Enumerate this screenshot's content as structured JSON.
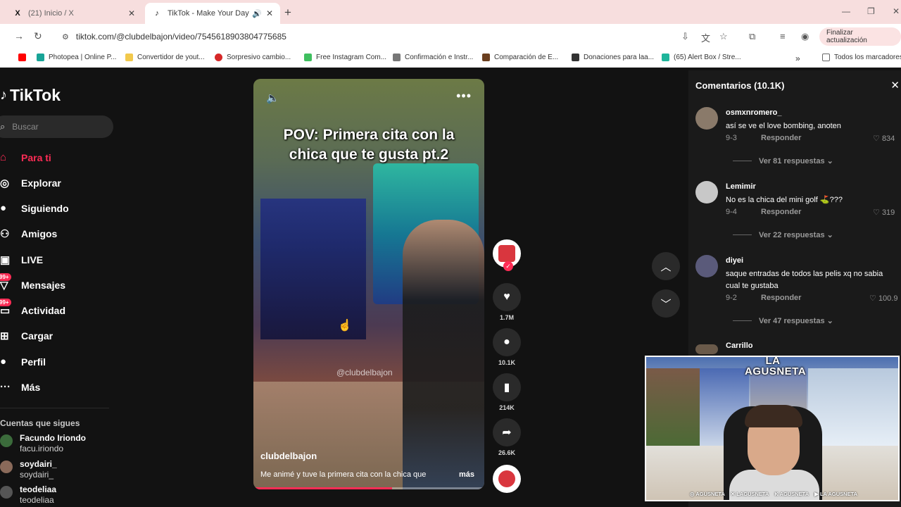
{
  "browser": {
    "tabs": [
      {
        "icon": "X",
        "title": "(21) Inicio / X",
        "close": "✕"
      },
      {
        "icon": "♪",
        "title": "TikTok - Make Your Day",
        "audio": "🔊",
        "close": "✕"
      }
    ],
    "new_tab": "+",
    "url": "tiktok.com/@clubdelbajon/video/7545618903804775685",
    "update_button": "Finalizar actualización",
    "bookmarks": [
      {
        "label": "",
        "color": "#ff0000"
      },
      {
        "label": "Photopea | Online P...",
        "color": "#18a497"
      },
      {
        "label": "Convertidor de yout...",
        "color": "#f2c94c"
      },
      {
        "label": "Sorpresivo cambio...",
        "color": "#d62828"
      },
      {
        "label": "Free Instagram Com...",
        "color": "#3fbf5f"
      },
      {
        "label": "Confirmación e Instr...",
        "color": "#777777"
      },
      {
        "label": "Comparación de E...",
        "color": "#6b3f1f"
      },
      {
        "label": "Donaciones para laa...",
        "color": "#333333"
      },
      {
        "label": "(65) Alert Box / Stre...",
        "color": "#1fb59b"
      },
      {
        "label": "Todos los marcadores",
        "color": "#666666"
      }
    ],
    "bookmarks_more": "»"
  },
  "sidebar": {
    "logo": "TikTok",
    "search_placeholder": "Buscar",
    "nav": [
      {
        "label": "Para ti",
        "icon": "⌂",
        "active": true
      },
      {
        "label": "Explorar",
        "icon": "◎"
      },
      {
        "label": "Siguiendo",
        "icon": "●"
      },
      {
        "label": "Amigos",
        "icon": "⚇"
      },
      {
        "label": "LIVE",
        "icon": "▣"
      },
      {
        "label": "Mensajes",
        "icon": "▽",
        "badge": "99+"
      },
      {
        "label": "Actividad",
        "icon": "▭",
        "badge": "99+"
      },
      {
        "label": "Cargar",
        "icon": "⊞"
      },
      {
        "label": "Perfil",
        "icon": "●"
      },
      {
        "label": "Más",
        "icon": "···"
      }
    ],
    "following_title": "Cuentas que sigues",
    "following": [
      {
        "name": "Facundo Iriondo",
        "handle": "facu.iriondo",
        "color": "#3b6b3b"
      },
      {
        "name": "soydairi_",
        "handle": "soydairi_",
        "color": "#8a6a5a"
      },
      {
        "name": "teodeliaa",
        "handle": "teodeliaa",
        "color": "#555555"
      }
    ]
  },
  "video": {
    "caption_line1": "POV: Primera cita con la",
    "caption_line2": "chica que te gusta pt.2",
    "watermark": "@clubdelbajon",
    "author": "clubdelbajon",
    "description": "Me animé y tuve la primera cita con la chica que",
    "more": "más",
    "progress": 0.6
  },
  "actions": {
    "likes": "1.7M",
    "comments": "10.1K",
    "saves": "214K",
    "shares": "26.6K"
  },
  "comments": {
    "title": "Comentarios (10.1K)",
    "reply_label": "Responder",
    "items": [
      {
        "user": "osmxnromero_",
        "text": "así se ve el love bombing, anoten",
        "date": "9-3",
        "likes": "834",
        "more": "Ver 81 respuestas",
        "color": "#8a7a6a"
      },
      {
        "user": "Lemimir",
        "text": "No es la chica del mini golf ⛳???",
        "date": "9-4",
        "likes": "319",
        "more": "Ver 22 respuestas",
        "color": "#c8c8c8"
      },
      {
        "user": "diyei",
        "text": "saque entradas de todos las pelis xq no sabia cual te gustaba",
        "date": "9-2",
        "likes": "100.9",
        "more": "Ver 47 respuestas",
        "color": "#5a5a7a"
      }
    ],
    "partial_user": "Carrillo"
  },
  "webcam": {
    "brand_line1": "LA",
    "brand_line2": "AGUSNETA",
    "socials": [
      "◎ AGUSNETA",
      "✕ LAGUSNETA",
      "K AGUSNETA",
      "▶ LA AGUSNETA"
    ]
  }
}
